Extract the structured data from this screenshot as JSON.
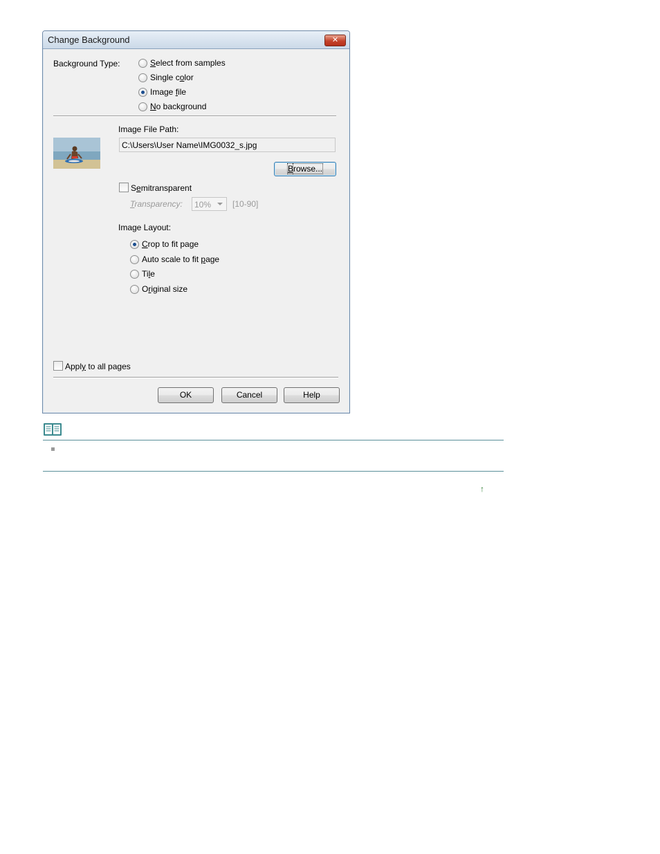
{
  "dialog": {
    "title": "Change Background",
    "close_glyph": "✕",
    "background_type": {
      "label": "Background Type:",
      "options": [
        {
          "pre": "",
          "key": "S",
          "post": "elect from samples",
          "checked": false
        },
        {
          "pre": "Single c",
          "key": "o",
          "post": "lor",
          "checked": false
        },
        {
          "pre": "Image ",
          "key": "f",
          "post": "ile",
          "checked": true
        },
        {
          "pre": "",
          "key": "N",
          "post": "o background",
          "checked": false
        }
      ]
    },
    "image_file_path": {
      "label": "Image File Path:",
      "value": "C:\\Users\\User Name\\IMG0032_s.jpg",
      "browse_key": "B",
      "browse_rest": "rowse..."
    },
    "semitransparent": {
      "key_pre": "S",
      "key": "e",
      "post": "mitransparent",
      "checked": false
    },
    "transparency": {
      "key": "T",
      "post": "ransparency:",
      "value": "10%",
      "range": "[10-90]"
    },
    "image_layout": {
      "label": "Image Layout:",
      "options": [
        {
          "pre": "",
          "key": "C",
          "post": "rop to fit page",
          "checked": true
        },
        {
          "pre": "Auto scale to fit ",
          "key": "p",
          "post": "age",
          "checked": false
        },
        {
          "pre": "Ti",
          "key": "l",
          "post": "e",
          "checked": false
        },
        {
          "pre": "O",
          "key": "r",
          "post": "iginal size",
          "checked": false
        }
      ]
    },
    "apply_all": {
      "pre": "Appl",
      "key": "y",
      "post": " to all pages",
      "checked": false
    },
    "buttons": {
      "ok": "OK",
      "cancel": "Cancel",
      "help": "Help"
    }
  },
  "page": {
    "top_arrow": "↑"
  },
  "colors": {
    "note_rule": "#5a8f9a",
    "note_icon": "#3b8a8f",
    "top_arrow": "#2e7d32"
  }
}
